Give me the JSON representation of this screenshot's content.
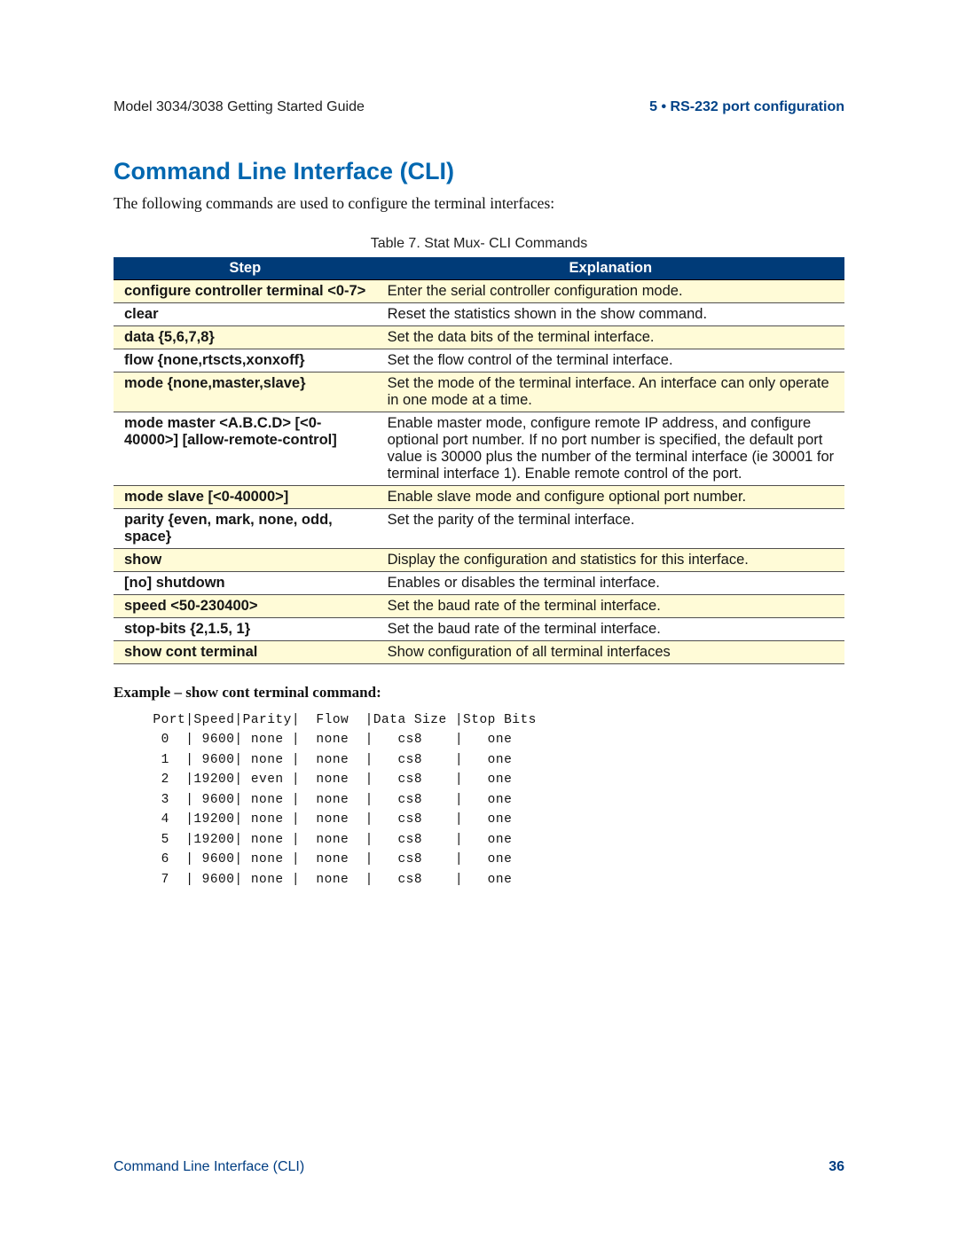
{
  "header": {
    "left": "Model 3034/3038 Getting Started Guide",
    "right": "5 • RS-232 port configuration"
  },
  "title": "Command Line Interface (CLI)",
  "intro": "The following commands are used to configure the terminal interfaces:",
  "table_caption": "Table 7. Stat Mux- CLI Commands",
  "columns": {
    "step": "Step",
    "explanation": "Explanation"
  },
  "rows": [
    {
      "step": "configure controller terminal <0-7>",
      "exp": "Enter the serial controller configuration mode.",
      "cls": "yellow"
    },
    {
      "step": "clear",
      "exp": "Reset the statistics shown in the show command.",
      "cls": "white"
    },
    {
      "step": "data {5,6,7,8}",
      "exp": "Set the data bits of the terminal interface.",
      "cls": "yellow"
    },
    {
      "step": "flow {none,rtscts,xonxoff}",
      "exp": "Set the flow control of the terminal interface.",
      "cls": "white"
    },
    {
      "step": "mode {none,master,slave}",
      "exp": "Set the mode of the terminal interface. An interface can only operate in one mode at a time.",
      "cls": "yellow"
    },
    {
      "step": "mode master <A.B.C.D> [<0-40000>] [allow-remote-control]",
      "exp": "Enable master mode, configure remote IP address, and configure optional port number. If no port number is specified, the default port value is 30000 plus the number of the terminal interface (ie 30001 for terminal interface 1). Enable remote control of the port.",
      "cls": "white"
    },
    {
      "step": "mode slave [<0-40000>]",
      "exp": "Enable slave mode and configure optional port number.",
      "cls": "yellow"
    },
    {
      "step": "parity {even, mark, none, odd, space}",
      "exp": "Set the parity of the terminal interface.",
      "cls": "white"
    },
    {
      "step": "show",
      "exp": "Display the configuration and statistics for this interface.",
      "cls": "yellow"
    },
    {
      "step": "[no] shutdown",
      "exp": "Enables or disables the terminal interface.",
      "cls": "white"
    },
    {
      "step": "speed <50-230400>",
      "exp": "Set the baud rate of the terminal interface.",
      "cls": "yellow"
    },
    {
      "step": "stop-bits {2,1.5, 1}",
      "exp": "Set the baud rate of the terminal interface.",
      "cls": "white"
    },
    {
      "step": "show cont terminal",
      "exp": "Show configuration of all terminal interfaces",
      "cls": "yellow"
    }
  ],
  "example_title": "Example – show cont terminal command:",
  "terminal": "  Port|Speed|Parity|  Flow  |Data Size |Stop Bits\n   0  | 9600| none |  none  |   cs8    |   one\n   1  | 9600| none |  none  |   cs8    |   one\n   2  |19200| even |  none  |   cs8    |   one\n   3  | 9600| none |  none  |   cs8    |   one\n   4  |19200| none |  none  |   cs8    |   one\n   5  |19200| none |  none  |   cs8    |   one\n   6  | 9600| none |  none  |   cs8    |   one\n   7  | 9600| none |  none  |   cs8    |   one",
  "footer": {
    "left": "Command Line Interface (CLI)",
    "right": "36"
  }
}
